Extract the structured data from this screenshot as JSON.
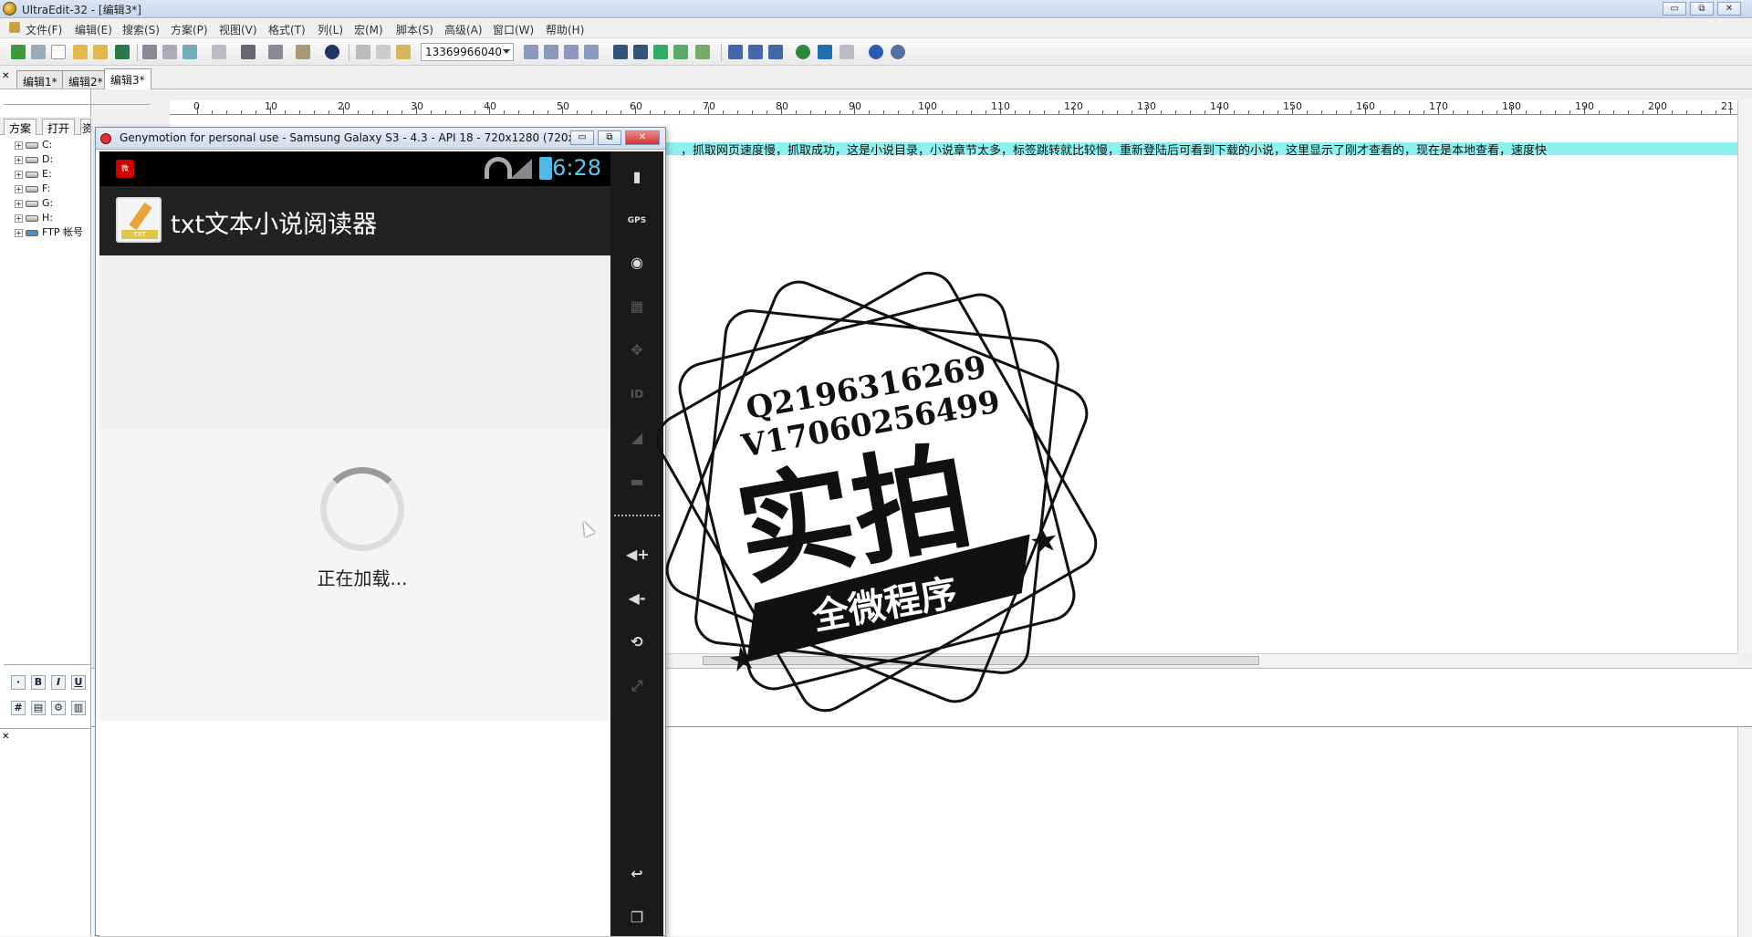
{
  "window": {
    "title": "UltraEdit-32 - [编辑3*]",
    "min": "▭",
    "max": "⧉",
    "close": "✕"
  },
  "menu": [
    "文件(F)",
    "编辑(E)",
    "搜索(S)",
    "方案(P)",
    "视图(V)",
    "格式(T)",
    "列(L)",
    "宏(M)",
    "脚本(S)",
    "高级(A)",
    "窗口(W)",
    "帮助(H)"
  ],
  "toolbar": {
    "combo_value": "13369966040"
  },
  "tabs": [
    "编辑1*",
    "编辑2*",
    "编辑3*"
  ],
  "left_panel": {
    "tabs": [
      "方案",
      "打开",
      "资源管理器"
    ],
    "drives": [
      "C:",
      "D:",
      "E:",
      "F:",
      "G:",
      "H:",
      "FTP 帐号"
    ]
  },
  "editor": {
    "line": "，抓取网页速度慢，抓取成功，这是小说目录，小说章节太多，标签跳转就比较慢，重新登陆后可看到下载的小说，这里显示了刚才查看的，现在是本地查看，速度快",
    "ruler": [
      "0",
      "10",
      "20",
      "30",
      "40",
      "50",
      "60",
      "70",
      "80",
      "90",
      "100",
      "110",
      "120",
      "130",
      "140",
      "150",
      "160",
      "170",
      "180",
      "190",
      "200",
      "21"
    ]
  },
  "emulator": {
    "title": "Genymotion for personal use - Samsung Galaxy S3 - 4.3 - API 18 - 720x1280 (720x...",
    "clock": "6:28",
    "app_title": "txt文本小说阅读器",
    "app_icon_label": "TXT",
    "loading_text": "正在加载...",
    "sidebar_icons": [
      "battery-icon",
      "gps-icon",
      "camera-icon",
      "clapper-icon",
      "dpad-icon",
      "id-icon",
      "rss-icon",
      "sms-icon",
      "volume-up-icon",
      "volume-down-icon",
      "rotate-icon",
      "fullscreen-icon",
      "back-icon",
      "recents-icon"
    ],
    "gps_label": "GPS",
    "id_label": "ID"
  },
  "watermark": {
    "line1": "Q2196316269",
    "line2": "V17060256499",
    "big": "实拍",
    "banner": "全微程序"
  }
}
